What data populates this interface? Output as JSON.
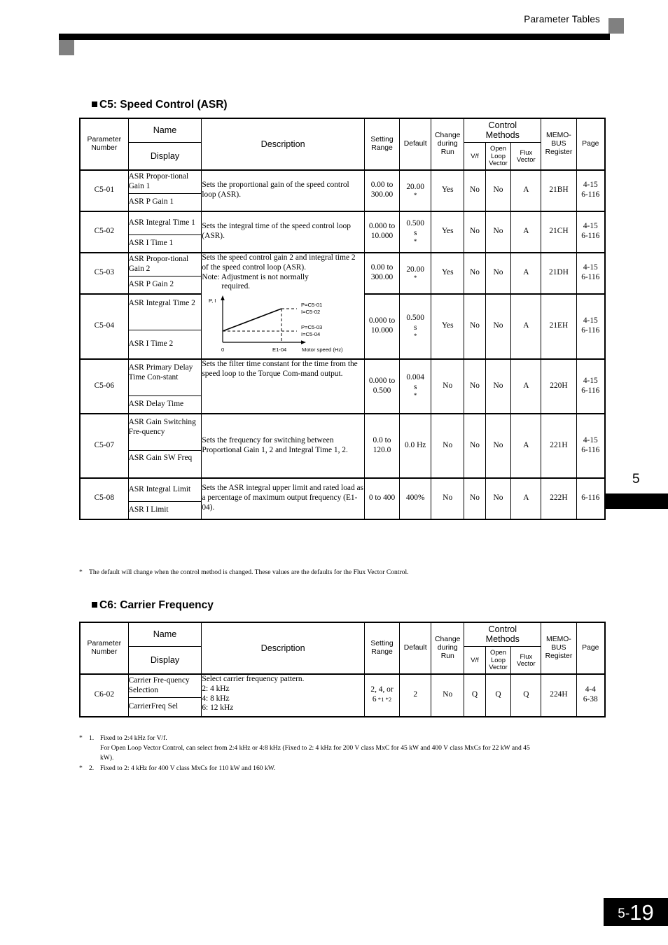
{
  "header": {
    "title": "Parameter Tables"
  },
  "footer": {
    "chapter": "5-",
    "page": "19",
    "chapter_tab": "5"
  },
  "table_header": {
    "parameter_number": "Parameter Number",
    "parameter_number_l1": "Parameter",
    "parameter_number_l2": "Number",
    "name": "Name",
    "display": "Display",
    "description": "Description",
    "setting_range_l1": "Setting",
    "setting_range_l2": "Range",
    "default": "Default",
    "change_l1": "Change",
    "change_l2": "during",
    "change_l3": "Run",
    "control_methods_l1": "Control",
    "control_methods_l2": "Methods",
    "vf": "V/f",
    "open_loop_l1": "Open",
    "open_loop_l2": "Loop",
    "open_loop_l3": "Vector",
    "flux_l1": "Flux",
    "flux_l2": "Vector",
    "memobus_l1": "MEMO-",
    "memobus_l2": "BUS",
    "memobus_l3": "Register",
    "page": "Page"
  },
  "c5": {
    "heading": "C5: Speed Control (ASR)",
    "rows": [
      {
        "param": "C5-01",
        "name": "ASR Propor-­tional Gain 1",
        "display": "ASR P Gain 1",
        "description": "Sets the proportional gain of the speed control loop (ASR).",
        "range_l1": "0.00 to",
        "range_l2": "300.00",
        "default_l1": "20.00",
        "default_l2": "",
        "default_star": "*",
        "change": "Yes",
        "vf": "No",
        "olv": "No",
        "fv": "A",
        "memobus": "21BH",
        "page_l1": "4-15",
        "page_l2": "6-116"
      },
      {
        "param": "C5-02",
        "name": "ASR Integral Time 1",
        "display": "ASR I Time 1",
        "description": "Sets the integral time of the speed control loop (ASR).",
        "range_l1": "0.000 to",
        "range_l2": "10.000",
        "default_l1": "0.500",
        "default_l2": "s",
        "default_star": "*",
        "change": "Yes",
        "vf": "No",
        "olv": "No",
        "fv": "A",
        "memobus": "21CH",
        "page_l1": "4-15",
        "page_l2": "6-116"
      },
      {
        "param": "C5-03",
        "name": "ASR Propor-­tional Gain 2",
        "display": "ASR P Gain 2",
        "description": "Sets the speed control gain 2 and integral time 2 of the speed control loop (ASR).",
        "description_note": "Note: Adjustment is not normally",
        "description_note2": "required.",
        "range_l1": "0.00 to",
        "range_l2": "300.00",
        "default_l1": "20.00",
        "default_l2": "",
        "default_star": "*",
        "change": "Yes",
        "vf": "No",
        "olv": "No",
        "fv": "A",
        "memobus": "21DH",
        "page_l1": "4-15",
        "page_l2": "6-116"
      },
      {
        "param": "C5-04",
        "name": "ASR Integral Time 2",
        "display": "ASR I Time 2",
        "description": "",
        "range_l1": "0.000 to",
        "range_l2": "10.000",
        "default_l1": "0.500",
        "default_l2": "s",
        "default_star": "*",
        "change": "Yes",
        "vf": "No",
        "olv": "No",
        "fv": "A",
        "memobus": "21EH",
        "page_l1": "4-15",
        "page_l2": "6-116"
      },
      {
        "param": "C5-06",
        "name": "ASR Primary Delay Time Con-­stant",
        "display": "ASR Delay Time",
        "description": "Sets the filter time constant for the time from the speed loop to the Torque Com-­mand output.",
        "range_l1": "0.000 to",
        "range_l2": "0.500",
        "default_l1": "0.004",
        "default_l2": "s",
        "default_star": "*",
        "change": "No",
        "vf": "No",
        "olv": "No",
        "fv": "A",
        "memobus": "220H",
        "page_l1": "4-15",
        "page_l2": "6-116"
      },
      {
        "param": "C5-07",
        "name": "ASR Gain Switching Fre-­quency",
        "display": "ASR Gain SW Freq",
        "description": "Sets the frequency for switching between Proportional Gain 1, 2 and Integral Time 1, 2.",
        "range_l1": "0.0 to",
        "range_l2": "120.0",
        "default_l1": "0.0 Hz",
        "default_l2": "",
        "default_star": "",
        "change": "No",
        "vf": "No",
        "olv": "No",
        "fv": "A",
        "memobus": "221H",
        "page_l1": "4-15",
        "page_l2": "6-116"
      },
      {
        "param": "C5-08",
        "name": "ASR Integral Limit",
        "display": "ASR I Limit",
        "description": "Sets the ASR integral upper limit and rated load as a percentage of maximum output frequency (E1-04).",
        "range_l1": "0 to 400",
        "range_l2": "",
        "default_l1": "400%",
        "default_l2": "",
        "default_star": "",
        "change": "No",
        "vf": "No",
        "olv": "No",
        "fv": "A",
        "memobus": "222H",
        "page_l1": "6-116",
        "page_l2": ""
      }
    ],
    "graph": {
      "y_label": "P, I",
      "x_label": "Motor speed (Hz)",
      "origin": "0",
      "x_tick": "E1-04",
      "ann_top_1": "P=C5-01",
      "ann_top_2": "I=C5-02",
      "ann_bot_1": "P=C5-03",
      "ann_bot_2": "I=C5-04"
    },
    "footnote": "The default will change when the control method is changed. These values are the defaults for the Flux Vector Control.",
    "footnote_mark": "*"
  },
  "c6": {
    "heading": "C6: Carrier Frequency",
    "rows": [
      {
        "param": "C6-02",
        "name": "Carrier Fre-­quency Selection",
        "display": "CarrierFreq Sel",
        "description_l1": "Select carrier frequency pattern.",
        "description_l2": "2:    4 kHz",
        "description_l3": "4:    8 kHz",
        "description_l4": "6:   12 kHz",
        "range_l1": "2, 4, or",
        "range_l2": "6",
        "range_star": "*1 *2",
        "default_l1": "2",
        "change": "No",
        "vf": "Q",
        "olv": "Q",
        "fv": "Q",
        "memobus": "224H",
        "page_l1": "4-4",
        "page_l2": "6-38"
      }
    ],
    "footnotes": [
      {
        "mark": "*",
        "num": "1.",
        "line1": "Fixed to 2:4 kHz for V/f.",
        "line2": "For Open Loop Vector Control, can select from 2:4 kHz or 4:8 kHz (Fixed to 2: 4 kHz for 200 V class MxC for 45 kW and 400 V class MxCs for 22 kW and 45",
        "line3": "kW)."
      },
      {
        "mark": "*",
        "num": "2.",
        "line1": "Fixed to 2: 4 kHz for 400 V class MxCs for 110 kW and 160 kW.",
        "line2": "",
        "line3": ""
      }
    ]
  }
}
